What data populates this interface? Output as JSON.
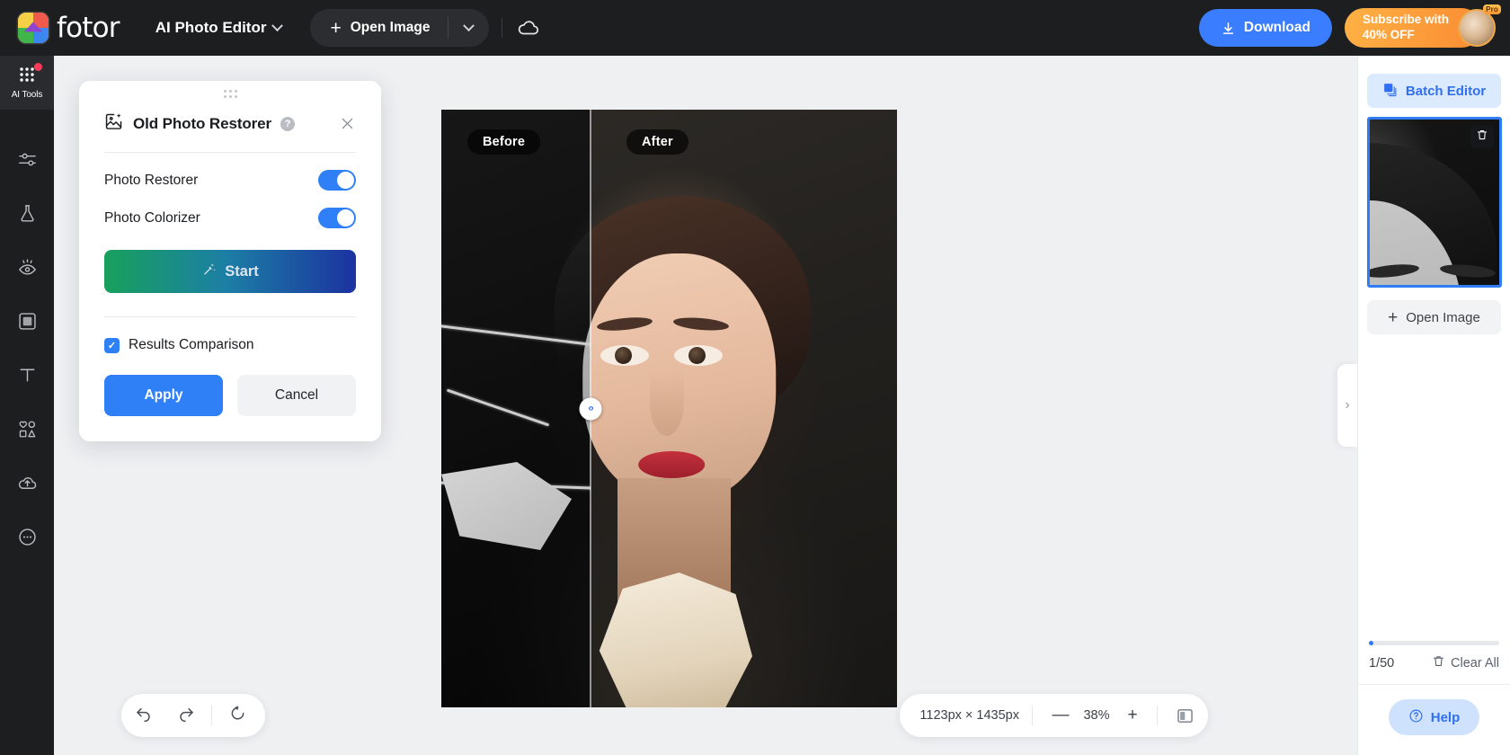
{
  "topbar": {
    "brand": "fotor",
    "app_name": "AI Photo Editor",
    "open_image": "Open Image",
    "download": "Download",
    "subscribe": "Subscribe with\n40% OFF",
    "pro_badge": "Pro",
    "icons": {
      "brand_logo": "fotor-logo-icon",
      "app_caret": "chevron-down-icon",
      "plus": "plus-icon",
      "open_caret": "chevron-down-icon",
      "cloud": "cloud-save-icon",
      "download": "download-icon",
      "avatar": "user-avatar"
    }
  },
  "sidebar": {
    "items": [
      {
        "label": "AI Tools",
        "icon": "grid-dots-icon",
        "active": true,
        "badge": true
      },
      {
        "label": "",
        "icon": "sliders-adjust-icon",
        "active": false,
        "badge": false
      },
      {
        "label": "",
        "icon": "flask-beauty-icon",
        "active": false,
        "badge": false
      },
      {
        "label": "",
        "icon": "eye-retouch-icon",
        "active": false,
        "badge": false
      },
      {
        "label": "",
        "icon": "frame-square-icon",
        "active": false,
        "badge": false
      },
      {
        "label": "",
        "icon": "text-tool-icon",
        "active": false,
        "badge": false
      },
      {
        "label": "",
        "icon": "elements-shapes-icon",
        "active": false,
        "badge": false
      },
      {
        "label": "",
        "icon": "cloud-upload-icon",
        "active": false,
        "badge": false
      },
      {
        "label": "",
        "icon": "more-dots-icon",
        "active": false,
        "badge": false
      }
    ]
  },
  "panel": {
    "title": "Old Photo Restorer",
    "help_glyph": "?",
    "close_glyph": "✕",
    "rows": [
      {
        "label": "Photo Restorer",
        "state": "on"
      },
      {
        "label": "Photo Colorizer",
        "state": "on"
      }
    ],
    "start_label": "Start",
    "start_icon": "magic-wand-icon",
    "comparison_label": "Results Comparison",
    "comparison_checked": true,
    "check_glyph": "✓",
    "apply_label": "Apply",
    "cancel_label": "Cancel",
    "gradient_from": "#18a05c",
    "gradient_to": "#1c32a0"
  },
  "canvas": {
    "before_label": "Before",
    "after_label": "After",
    "handle_glyph": "‹›",
    "collapse_glyph": "›"
  },
  "bottom": {
    "undo_icon": "undo-arrow-icon",
    "redo_icon": "redo-arrow-icon",
    "reset_icon": "reset-circular-arrow-icon",
    "dimensions": "1123px × 1435px",
    "zoom_out_glyph": "—",
    "zoom_level": "38%",
    "zoom_in_glyph": "+",
    "compare_icon": "split-compare-icon"
  },
  "right_panel": {
    "batch_editor": "Batch Editor",
    "batch_icon": "layers-stack-icon",
    "open_image": "Open Image",
    "open_plus": "+",
    "delete_icon": "trash-icon",
    "count": "1/50",
    "progress_percent": 2,
    "clear_all": "Clear All",
    "clear_icon": "trash-icon",
    "help_label": "Help",
    "help_icon": "question-circle-icon"
  },
  "colors": {
    "accent_blue": "#2f80f7",
    "dark_chrome": "#1d1e20",
    "subscribe_orange": "#fa8c32",
    "canvas_bg": "#eff0f2"
  }
}
